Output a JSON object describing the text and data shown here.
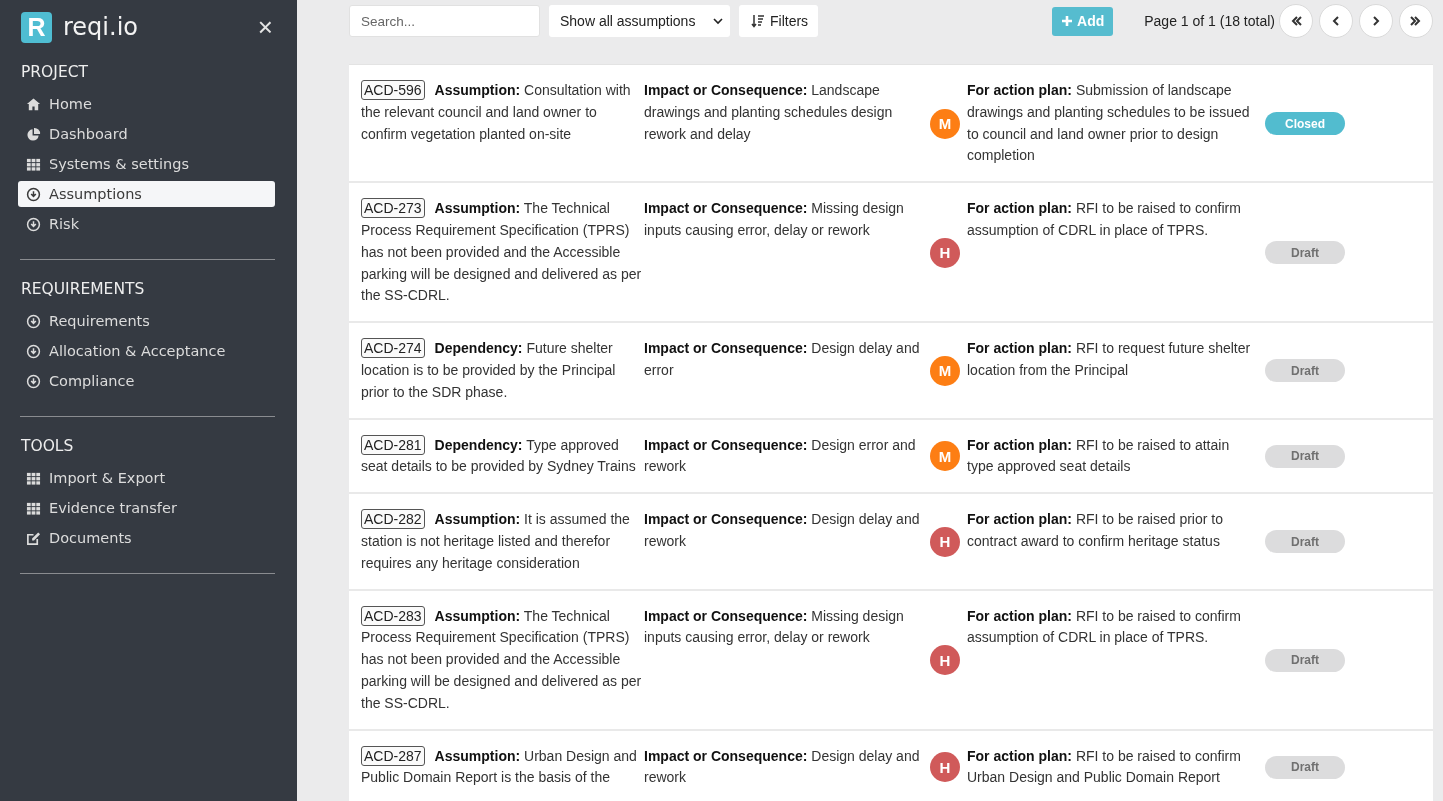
{
  "sidebar": {
    "logo": {
      "letter": "R",
      "name": "reqi.io"
    },
    "close": "×",
    "sections": [
      {
        "title": "PROJECT",
        "items": [
          {
            "label": "Home",
            "kind": "home",
            "selected": false
          },
          {
            "label": "Dashboard",
            "kind": "pie",
            "selected": false
          },
          {
            "label": "Systems & settings",
            "kind": "grid",
            "selected": false
          },
          {
            "label": "Assumptions",
            "kind": "down",
            "selected": true
          },
          {
            "label": "Risk",
            "kind": "down",
            "selected": false
          }
        ]
      },
      {
        "title": "REQUIREMENTS",
        "items": [
          {
            "label": "Requirements",
            "kind": "down",
            "selected": false
          },
          {
            "label": "Allocation & Acceptance",
            "kind": "down",
            "selected": false
          },
          {
            "label": "Compliance",
            "kind": "down",
            "selected": false
          }
        ]
      },
      {
        "title": "TOOLS",
        "items": [
          {
            "label": "Import & Export",
            "kind": "grid",
            "selected": false
          },
          {
            "label": "Evidence transfer",
            "kind": "grid",
            "selected": false
          },
          {
            "label": "Documents",
            "kind": "edit",
            "selected": false
          }
        ]
      }
    ]
  },
  "toolbar": {
    "search": {
      "placeholder": "Search..."
    },
    "filter_select": "Show all assumptions",
    "filters_button": "Filters",
    "add_button": "Add",
    "pagination": "Page 1 of 1 (18 total)"
  },
  "rows": [
    {
      "id": "ACD-596",
      "description": "**Assumption:** Consultation with the relevant council and land owner to confirm vegetation planted on-site",
      "impact": "**Impact or Consequence:** Landscape drawings and planting schedules design rework and delay",
      "risk": {
        "letter": "M",
        "color": "#fd7e14"
      },
      "action": "**For action plan:** Submission of landscape drawings and planting schedules to be issued to council and land owner prior to design completion",
      "status": {
        "label": "Closed",
        "kind": "closed"
      }
    },
    {
      "id": "ACD-273",
      "description": "**Assumption:** The Technical Process Requirement Specification (TPRS) has not been provided and the Accessible parking will be designed and delivered as per the SS-CDRL.",
      "impact": "**Impact or Consequence:** Missing design inputs causing error, delay or rework",
      "risk": {
        "letter": "H",
        "color": "#d05a5a"
      },
      "action": "**For action plan:** RFI to be raised to confirm assumption of CDRL in place of TPRS.",
      "status": {
        "label": "Draft",
        "kind": "draft"
      }
    },
    {
      "id": "ACD-274",
      "description": "**Dependency:** Future shelter location is to be provided by the Principal prior to the SDR phase.",
      "impact": "**Impact or Consequence:** Design delay and error",
      "risk": {
        "letter": "M",
        "color": "#fd7e14"
      },
      "action": "**For action plan:** RFI to request future shelter location from the Principal",
      "status": {
        "label": "Draft",
        "kind": "draft"
      }
    },
    {
      "id": "ACD-281",
      "description": "**Dependency:** Type approved seat details to be provided by Sydney Trains",
      "impact": "**Impact or Consequence:** Design error and rework",
      "risk": {
        "letter": "M",
        "color": "#fd7e14"
      },
      "action": "**For action plan:** RFI to be raised to attain type approved seat details",
      "status": {
        "label": "Draft",
        "kind": "draft"
      }
    },
    {
      "id": "ACD-282",
      "description": "**Assumption:** It is assumed the station is not heritage listed and therefor requires any heritage consideration",
      "impact": "**Impact or Consequence:** Design delay and rework",
      "risk": {
        "letter": "H",
        "color": "#d05a5a"
      },
      "action": "**For action plan:** RFI to be raised prior to contract award to confirm heritage status",
      "status": {
        "label": "Draft",
        "kind": "draft"
      }
    },
    {
      "id": "ACD-283",
      "description": "**Assumption:** The Technical Process Requirement Specification (TPRS) has not been provided and the Accessible parking will be designed and delivered as per the SS-CDRL.",
      "impact": "**Impact or Consequence:** Missing design inputs causing error, delay or rework",
      "risk": {
        "letter": "H",
        "color": "#d05a5a"
      },
      "action": "**For action plan:** RFI to be raised to confirm assumption of CDRL in place of TPRS.",
      "status": {
        "label": "Draft",
        "kind": "draft"
      }
    },
    {
      "id": "ACD-287",
      "description": "**Assumption:** Urban Design and Public Domain Report is the basis of the",
      "impact": "**Impact or Consequence:** Design delay and rework",
      "risk": {
        "letter": "H",
        "color": "#d05a5a"
      },
      "action": "**For action plan:** RFI to be raised to confirm Urban Design and Public Domain Report",
      "status": {
        "label": "Draft",
        "kind": "draft"
      }
    }
  ]
}
